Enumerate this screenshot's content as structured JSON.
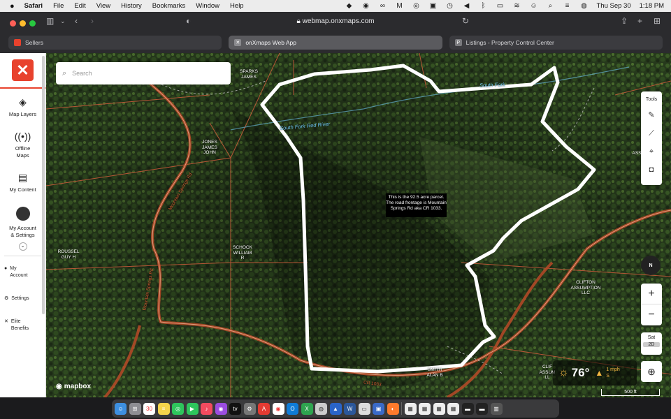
{
  "menubar": {
    "apple": "",
    "items": [
      "Safari",
      "File",
      "Edit",
      "View",
      "History",
      "Bookmarks",
      "Window",
      "Help"
    ],
    "date": "Thu Sep 30",
    "time": "1:18 PM"
  },
  "browser": {
    "url": "webmap.onxmaps.com",
    "tabs": [
      {
        "label": "Sellers",
        "icon": "sellers-icon"
      },
      {
        "label": "onXmaps Web App",
        "icon": "onx-icon"
      },
      {
        "label": "Listings - Property Control Center",
        "icon": "p-icon",
        "fav": "P"
      }
    ]
  },
  "sidebar": {
    "logo": "✕",
    "items": [
      {
        "label": "Map Layers",
        "icon": "layers-icon"
      },
      {
        "label": "Offline Maps",
        "icon": "offline-icon"
      },
      {
        "label": "My Content",
        "icon": "content-icon"
      },
      {
        "label": "My Account & Settings",
        "icon": "avatar-icon"
      }
    ],
    "small": [
      {
        "label": "My Account",
        "icon": "person-icon"
      },
      {
        "label": "Settings",
        "icon": "gear-icon"
      },
      {
        "label": "Elite Benefits",
        "icon": "close-icon"
      }
    ]
  },
  "search": {
    "placeholder": "Search"
  },
  "tools": {
    "label": "Tools"
  },
  "controls": {
    "north": "N",
    "zoom_in": "+",
    "zoom_out": "−",
    "sat": "Sat",
    "mode": "2D"
  },
  "weather": {
    "temp": "76°",
    "wind_speed": "1 mph",
    "wind_dir": "S"
  },
  "scale": "500 ft",
  "attribution": "mapbox",
  "note": "This is the 92.5 acre parcel. The road frontage is Mountain Springs Rd aka CR 1033.",
  "owners": [
    {
      "label": "SPARKS JAMES"
    },
    {
      "label": "JONES JAMES JOHN"
    },
    {
      "label": "ROUSSEL GUY H"
    },
    {
      "label": "SCHOCK WILLIAM R"
    },
    {
      "label": "CLIFTON ASSUMPTION LLC"
    },
    {
      "label": "SMITH ALAN B"
    },
    {
      "label": "CLIF ASSUM LL"
    },
    {
      "label": "ASS"
    }
  ],
  "rivers": [
    {
      "label": "South Fork Red River"
    },
    {
      "label": "South Fork"
    }
  ],
  "roads": [
    {
      "label": "Mountain Springs Rd"
    },
    {
      "label": "Mountain Springs Rd"
    },
    {
      "label": "CR 1033"
    }
  ],
  "colors": {
    "brand": "#e8422d",
    "boundary": "#ffffff",
    "parcel_lines": "#c75a3a",
    "river_text": "#6fc5ef"
  }
}
